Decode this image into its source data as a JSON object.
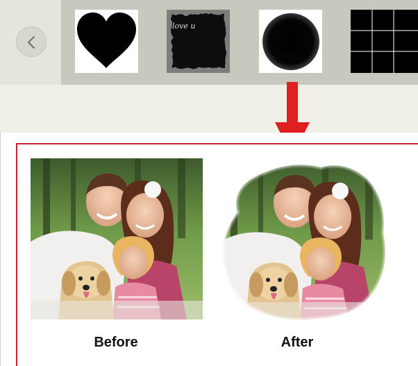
{
  "toolbar": {
    "back_icon": "chevron-left-icon",
    "masks": [
      {
        "name": "heart-mask",
        "icon": "heart-icon"
      },
      {
        "name": "love-u-mask",
        "icon": "brush-square-icon",
        "text": "love u"
      },
      {
        "name": "circle-mask",
        "icon": "soft-circle-icon"
      },
      {
        "name": "grid-mask",
        "icon": "grid-icon"
      }
    ]
  },
  "arrow": {
    "color": "#e02020",
    "icon": "arrow-down-icon"
  },
  "preview": {
    "frame_color": "#c8232c",
    "before_label": "Before",
    "after_label": "After"
  }
}
